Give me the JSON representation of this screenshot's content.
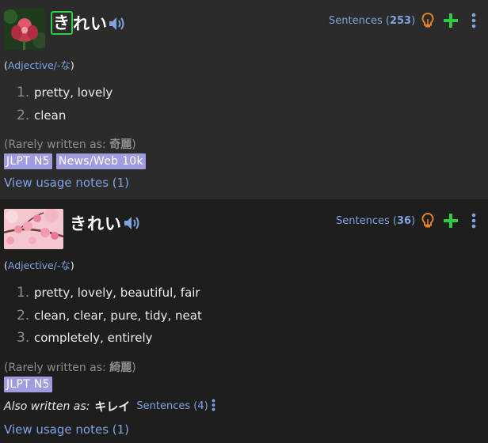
{
  "entries": [
    {
      "word_highlight": "き",
      "word_rest": "れい",
      "sentences_label": "Sentences (",
      "sentences_count": "253",
      "sentences_close": ")",
      "pos_open": "(",
      "pos_label": "Adjective/-な",
      "pos_close": ")",
      "senses": [
        {
          "num": "1.",
          "gloss": "pretty, lovely"
        },
        {
          "num": "2.",
          "gloss": "clean"
        }
      ],
      "rare_label": "(Rarely written as: ",
      "rare_kanji": "奇麗",
      "rare_close": ")",
      "tags": [
        "JLPT N5",
        "News/Web 10k"
      ],
      "usage_notes": "View usage notes (1)"
    },
    {
      "word_highlight": "",
      "word_rest": "きれい",
      "sentences_label": "Sentences (",
      "sentences_count": "36",
      "sentences_close": ")",
      "pos_open": "(",
      "pos_label": "Adjective/-な",
      "pos_close": ")",
      "senses": [
        {
          "num": "1.",
          "gloss": "pretty, lovely, beautiful, fair"
        },
        {
          "num": "2.",
          "gloss": "clean, clear, pure, tidy, neat"
        },
        {
          "num": "3.",
          "gloss": "completely, entirely"
        }
      ],
      "rare_label": "(Rarely written as: ",
      "rare_kanji": "綺麗",
      "rare_close": ")",
      "tags": [
        "JLPT N5"
      ],
      "also_label": "Also written as:",
      "also_word": "キレイ",
      "also_sentences": "Sentences (4)",
      "usage_notes": "View usage notes (1)"
    }
  ],
  "colors": {
    "accent_blue": "#7fa3e3",
    "tag_purple": "#9f9ce0",
    "plus_green": "#2ecc40",
    "bulb_orange": "#e8822a",
    "highlight_green": "#2ecc40"
  },
  "icons": [
    "flower-thumbnail",
    "speaker-icon",
    "lightbulb-icon",
    "plus-icon",
    "kebab-menu-icon"
  ]
}
